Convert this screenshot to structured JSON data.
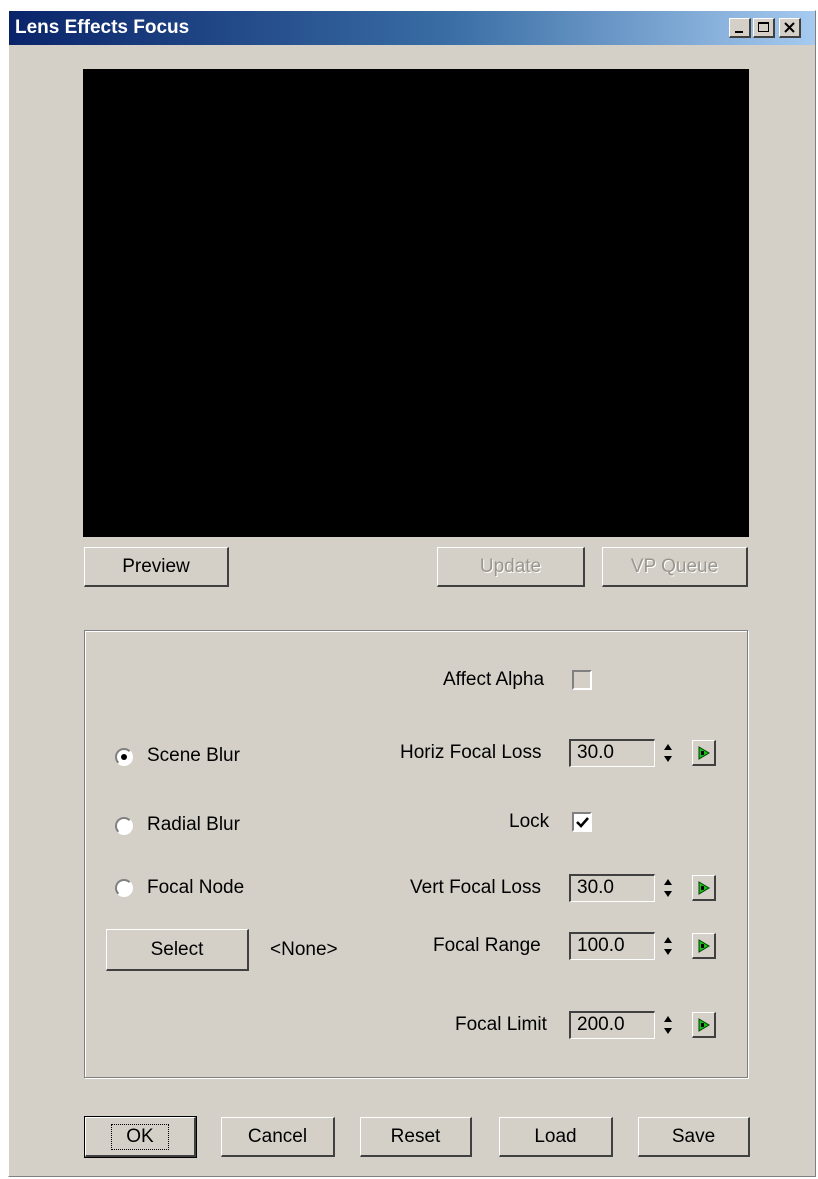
{
  "window": {
    "title": "Lens Effects Focus",
    "controls": [
      "minimize-icon",
      "maximize-icon",
      "close-icon"
    ]
  },
  "preview_buttons": {
    "preview": "Preview",
    "update": "Update",
    "vp_queue": "VP Queue"
  },
  "options": {
    "affect_alpha": {
      "label": "Affect Alpha",
      "checked": false
    },
    "radios": [
      {
        "label": "Scene Blur",
        "selected": true
      },
      {
        "label": "Radial Blur",
        "selected": false
      },
      {
        "label": "Focal Node",
        "selected": false
      }
    ],
    "select_button": "Select",
    "node_value": "<None>",
    "lock": {
      "label": "Lock",
      "checked": true
    },
    "params": {
      "horiz_focal_loss": {
        "label": "Horiz Focal Loss",
        "value": "30.0"
      },
      "vert_focal_loss": {
        "label": "Vert Focal Loss",
        "value": "30.0"
      },
      "focal_range": {
        "label": "Focal Range",
        "value": "100.0"
      },
      "focal_limit": {
        "label": "Focal Limit",
        "value": "200.0"
      }
    }
  },
  "footer": {
    "ok": "OK",
    "cancel": "Cancel",
    "reset": "Reset",
    "load": "Load",
    "save": "Save"
  },
  "colors": {
    "window_face": "#d4d0c8",
    "title_gradient_start": "#0a246a",
    "title_gradient_end": "#a6caf0",
    "preview_background": "#000000",
    "key_icon_green": "#18c018"
  }
}
